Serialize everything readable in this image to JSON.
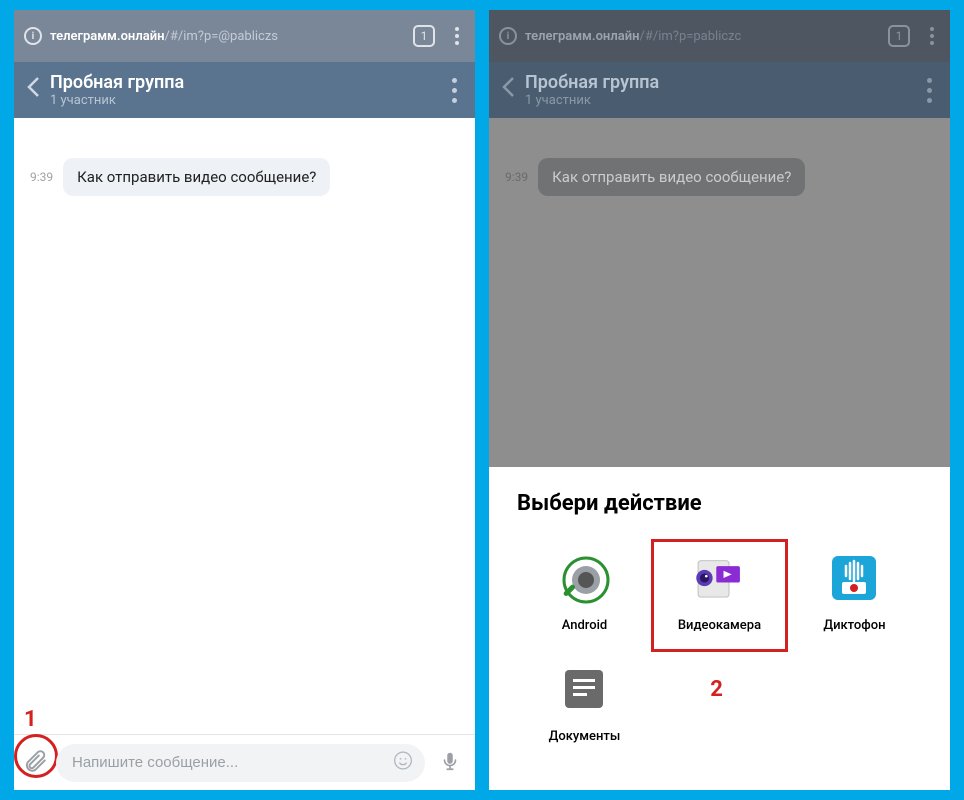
{
  "left": {
    "url_domain": "телеграмм.онлайн",
    "url_path": "/#/im?p=@pabliczs",
    "tab_count": "1",
    "chat_title": "Пробная группа",
    "chat_subtitle": "1 участник",
    "msg_time": "9:39",
    "msg_text": "Как отправить видео сообщение?",
    "input_placeholder": "Напишите сообщение...",
    "callout": "1"
  },
  "right": {
    "url_domain": "телеграмм.онлайн",
    "url_path": "/#/im?p=pabliczc",
    "tab_count": "1",
    "chat_title": "Пробная группа",
    "chat_subtitle": "1 участник",
    "msg_time": "9:39",
    "msg_text": "Как отправить видео сообщение?",
    "sheet_title": "Выбери действие",
    "items": [
      {
        "label": "Android"
      },
      {
        "label": "Видеокамера"
      },
      {
        "label": "Диктофон"
      },
      {
        "label": "Документы"
      }
    ],
    "callout": "2"
  }
}
